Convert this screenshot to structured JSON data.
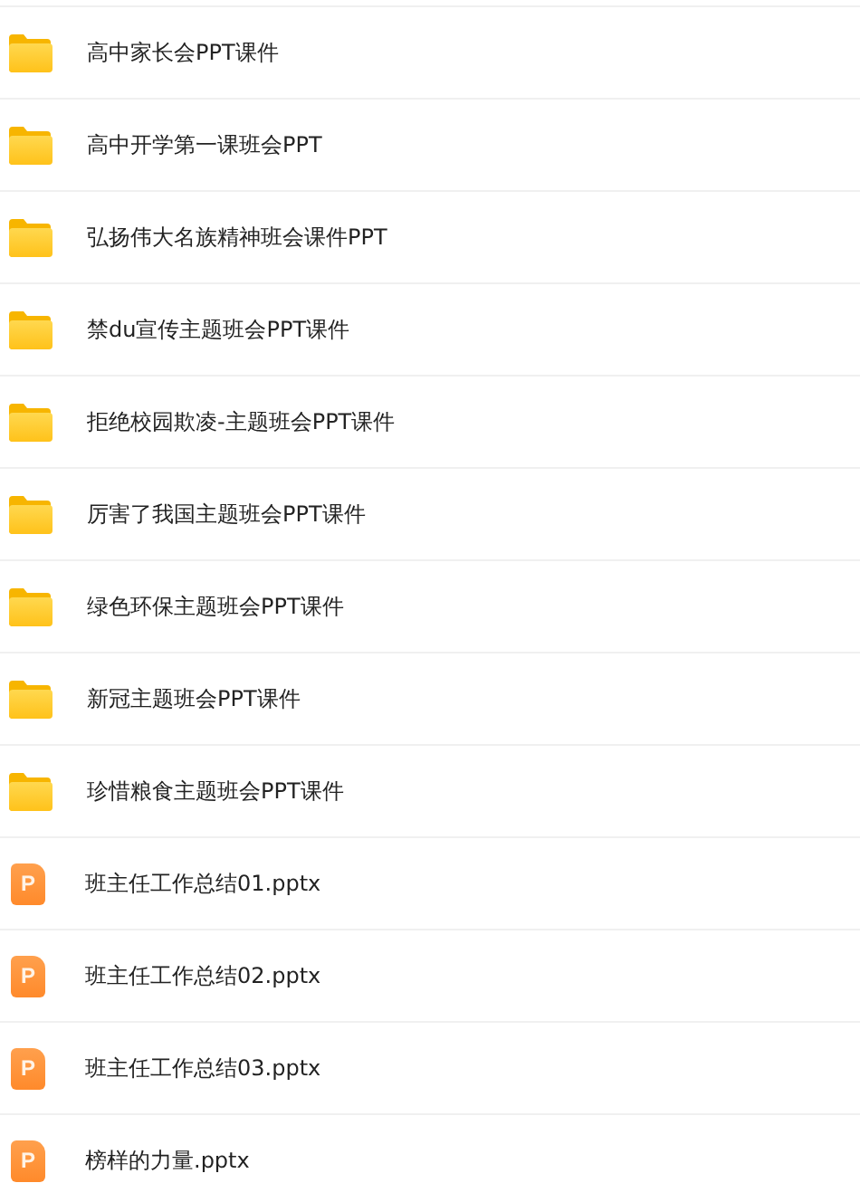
{
  "files": [
    {
      "kind": "folder",
      "name": "高中家长会PPT课件"
    },
    {
      "kind": "folder",
      "name": "高中开学第一课班会PPT"
    },
    {
      "kind": "folder",
      "name": "弘扬伟大名族精神班会课件PPT"
    },
    {
      "kind": "folder",
      "name": "禁du宣传主题班会PPT课件"
    },
    {
      "kind": "folder",
      "name": "拒绝校园欺凌-主题班会PPT课件"
    },
    {
      "kind": "folder",
      "name": "厉害了我国主题班会PPT课件"
    },
    {
      "kind": "folder",
      "name": "绿色环保主题班会PPT课件"
    },
    {
      "kind": "folder",
      "name": "新冠主题班会PPT课件"
    },
    {
      "kind": "folder",
      "name": "珍惜粮食主题班会PPT课件"
    },
    {
      "kind": "pptx",
      "name": "班主任工作总结01.pptx",
      "icon_letter": "P"
    },
    {
      "kind": "pptx",
      "name": "班主任工作总结02.pptx",
      "icon_letter": "P"
    },
    {
      "kind": "pptx",
      "name": "班主任工作总结03.pptx",
      "icon_letter": "P"
    },
    {
      "kind": "pptx",
      "name": "榜样的力量.pptx",
      "icon_letter": "P"
    }
  ]
}
